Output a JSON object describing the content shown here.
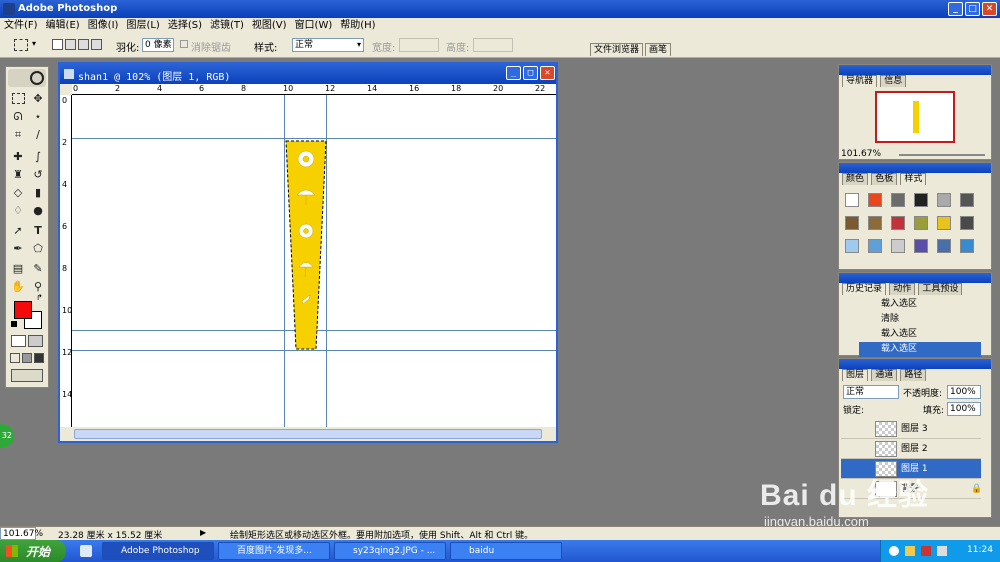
{
  "app": {
    "title": "Adobe Photoshop",
    "menus": [
      "文件(F)",
      "编辑(E)",
      "图像(I)",
      "图层(L)",
      "选择(S)",
      "滤镜(T)",
      "视图(V)",
      "窗口(W)",
      "帮助(H)"
    ]
  },
  "options": {
    "feather_label": "羽化:",
    "feather_value": "0 像素",
    "antialias_label": "消除锯齿",
    "style_label": "样式:",
    "style_value": "正常",
    "width_label": "宽度:",
    "height_label": "高度:",
    "tab_file_browser": "文件浏览器",
    "tab_brushes": "画笔"
  },
  "document": {
    "title": "shan1 @ 102% (图层 1, RGB)",
    "ruler_h": [
      "0",
      "2",
      "4",
      "6",
      "8",
      "10",
      "12",
      "14",
      "16",
      "18",
      "20",
      "22"
    ],
    "ruler_v": [
      "0",
      "2",
      "4",
      "6",
      "8",
      "10",
      "12",
      "14"
    ],
    "fan_color": "#f7d000"
  },
  "navigator": {
    "tabs": [
      "导航器",
      "信息"
    ],
    "zoom": "101.67%"
  },
  "swatches": {
    "tabs": [
      "颜色",
      "色板",
      "样式"
    ]
  },
  "history": {
    "tabs": [
      "历史记录",
      "动作",
      "工具预设"
    ],
    "items": [
      "载入选区",
      "清除",
      "载入选区",
      "载入选区"
    ]
  },
  "layers": {
    "tabs": [
      "图层",
      "通道",
      "路径"
    ],
    "blend": "正常",
    "opacity_label": "不透明度:",
    "opacity": "100%",
    "lock_label": "锁定:",
    "fill_label": "填充:",
    "fill": "100%",
    "items": [
      "图层 3",
      "图层 2",
      "图层 1",
      "背景"
    ]
  },
  "status": {
    "zoom": "101.67%",
    "doc_size": "23.28 厘米 x 15.52 厘米",
    "hint": "绘制矩形选区或移动选区外框。要用附加选项，使用 Shift、Alt 和 Ctrl 键。"
  },
  "taskbar": {
    "start": "开始",
    "tasks": [
      "Adobe Photoshop",
      "百度图片-发现多...",
      "sy23qing2.JPG - ...",
      "baidu"
    ],
    "time": "11:24"
  },
  "watermark": {
    "brand": "Bai du 经验",
    "url": "jingyan.baidu.com"
  },
  "badge": "32"
}
